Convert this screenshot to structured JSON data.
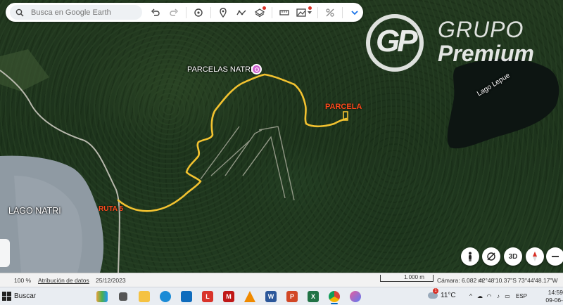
{
  "search": {
    "placeholder": "Busca en Google Earth"
  },
  "map": {
    "labels": {
      "lake_natri": "LAGO NATRI",
      "parcelas_natri": "PARCELAS NATRI",
      "lake_lepue": "Lago Lepue",
      "parcela": "PARCELA",
      "ruta": "RUTA 5"
    },
    "route_color": "#f2c230",
    "marker_color": "#d064d0",
    "label_accent": "#ff4a1c"
  },
  "logo": {
    "initials": "GP",
    "word1": "GRUPO",
    "word2": "Premium"
  },
  "controls": {
    "threed": "3D"
  },
  "statusbar": {
    "zoom": "100 %",
    "attribution": "Atribución de datos",
    "date": "25/12/2023",
    "scale": "1.000 m",
    "camera": "Cámara: 6.082 m",
    "coords": "42°48'10.37\"S 73°44'48.17\"W"
  },
  "taskbar": {
    "search": "Buscar",
    "temperature": "11°C",
    "weather_badge": "1",
    "language": "ESP",
    "time": "14:59",
    "date": "09-06-2026"
  },
  "icons": [
    "search-icon",
    "undo-icon",
    "redo-icon",
    "history-icon",
    "place-pin-icon",
    "path-icon",
    "layers-icon",
    "ruler-icon",
    "image-icon",
    "share-off-icon",
    "chevron-down-icon",
    "pegman-icon",
    "rotate-icon",
    "compass-icon",
    "minus-icon"
  ]
}
